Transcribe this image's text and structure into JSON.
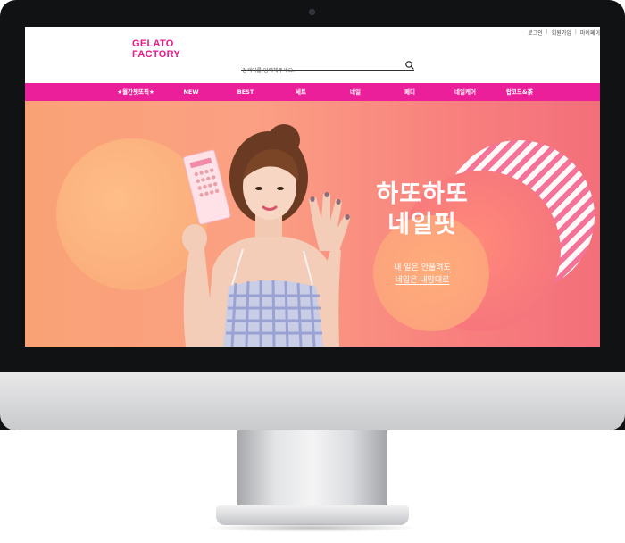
{
  "header": {
    "top_links": [
      "로그인",
      "회원가입",
      "마이페이"
    ],
    "logo": {
      "line1": "GELATO",
      "line2": "FACTORY"
    },
    "search": {
      "placeholder": "검색어를 입력해주세요."
    }
  },
  "nav": {
    "items": [
      "★월간챗또픽★",
      "NEW",
      "BEST",
      "세트",
      "네일",
      "페디",
      "네일케어",
      "랍코드&茶"
    ]
  },
  "hero": {
    "title_line1": "하또하또",
    "title_line2": "네일핏",
    "sub_line1": "내 일은 안풀려도",
    "sub_line2": "네일은 내맘대로"
  },
  "colors": {
    "brand_pink": "#ec1f9a",
    "hero_left": "#f9a276",
    "hero_right": "#f36f7a",
    "logo_accent": "#2ab4e8"
  },
  "icons": {
    "search": "search-icon",
    "camera": "webcam-icon"
  }
}
